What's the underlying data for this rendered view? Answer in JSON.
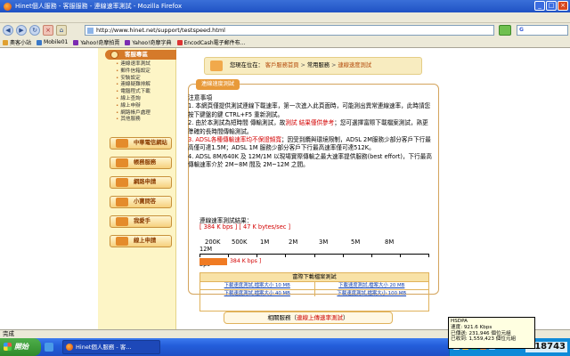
{
  "window": {
    "title": "Hinet個人服務 - 客服服務 - 連線速率測試 - Mozilla Firefox",
    "min_label": "_",
    "max_label": "□",
    "close_label": "×"
  },
  "toolbar": {
    "back_label": "◀",
    "forward_label": "▶",
    "reload_label": "↻",
    "stop_label": "×",
    "home_label": "⌂",
    "url": "http://www.hinet.net/support/testspeed.html",
    "search_engine": "G"
  },
  "bookmarks": [
    {
      "label": "奧客小站",
      "color": "#e0a030"
    },
    {
      "label": "Mobile01",
      "color": "#3a78c8"
    },
    {
      "label": "Yahoo!奇摩拍賣",
      "color": "#7b2bb2"
    },
    {
      "label": "Yahoo!奇摩字典",
      "color": "#7b2bb2"
    },
    {
      "label": "EncodCash電子郵件布...",
      "color": "#d33"
    }
  ],
  "sidebar": {
    "header": "客服專區",
    "items": [
      "連線速率測試",
      "郵件信箱設定",
      "安裝設定",
      "連線疑難排解",
      "電腦程式下載",
      "線上查詢",
      "線上申辦",
      "網路帳戶處理",
      "其他服務"
    ],
    "buttons": [
      "中華電信網站",
      "帳務服務",
      "網路申請",
      "小寶問答",
      "我愛手",
      "線上申請"
    ]
  },
  "location": {
    "prefix": "您現在位在：",
    "link1": "客戶服務首頁",
    "sep": " > ",
    "crumb2": "常用服務",
    "link2": "連線速度測試"
  },
  "speed_test": {
    "tab_label": "連線速度測試",
    "notice_title": "注意事項",
    "item1": "1. 本網頁僅提供測試連線下載速率，第一次進入此頁面時，可能測出異常連線速率，此時請您按下鍵盤的鍵 CTRL+F5 重新測試。",
    "item2a": "2. 由於本測試為短時間 傳輸測試，故",
    "item2b": "測試 結果僅供參考",
    "item2c": "；您可選擇富際下載檔案測試，熟更準確的長時間傳輸測試。",
    "item3a": "3. ADSL各種傳輸速率均不保證頻寬",
    "item3b": "；因受到纜與環境限制，ADSL 2M服務少部分客戶下行最高僅可達1.5M；ADSL 1M 服務少部分客戶下行最高速率僅可達512K。",
    "item4": "4. ADSL 8M/640K 及 12M/1M 以現場實際傳輸之最大速率提供服務(best effort)，下行最高傳輸速率介於 2M~8M 間及 2M~12M 之間。",
    "result_label": "連線速率測試結果：",
    "result_value": "[ 384 K bps ] [ 47 K bytes/sec ]",
    "scale_labels": [
      "200K",
      "500K",
      "1M",
      "2M",
      "3M",
      "5M",
      "8M",
      "12M"
    ],
    "unit_label": "bps",
    "measured_kbps": 384,
    "bar_label": "384 K bps ]"
  },
  "downloads": {
    "title": "富際下載檔案測試",
    "rows": [
      [
        "下載速度測試,檔案大小 10 MB",
        "下載速度測試,檔案大小 20 MB"
      ],
      [
        "下載速度測試,檔案大小 40 MB",
        "下載速度測試,檔案大小 100 MB"
      ]
    ]
  },
  "related": {
    "prefix": "相關服務（",
    "link": "連線上傳速率測試",
    "suffix": "）"
  },
  "status": {
    "text": "完成"
  },
  "taskbar": {
    "start_label": "開始",
    "task_label": "Hinet個人服務 - 客...",
    "tray_number": "#18743"
  },
  "tooltip": {
    "line1": "HSDPA",
    "line2": "速度: 921.6 Kbps",
    "line3": "已傳送: 231,946 個位元組",
    "line4": "已收到: 1,559,423 個位元組"
  }
}
